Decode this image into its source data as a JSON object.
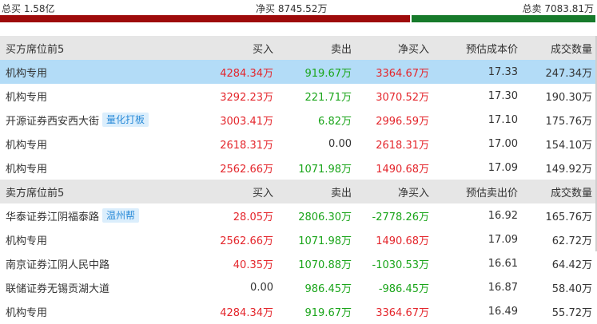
{
  "summary": {
    "buy_total": "总买 1.58亿",
    "net_total": "净买 8745.52万",
    "sell_total": "总卖 7083.81万",
    "buy_share": 0.689
  },
  "buy_section": {
    "headers": [
      "买方席位前5",
      "买入",
      "卖出",
      "净买入",
      "预估成本价",
      "成交数量"
    ],
    "rows": [
      {
        "name": "机构专用",
        "tag": "",
        "buy": "4284.34万",
        "sell": "919.67万",
        "net": "3364.67万",
        "price": "17.33",
        "volume": "247.34万",
        "net_color": "red",
        "sell_color": "green",
        "buy_color": "red",
        "selected": true
      },
      {
        "name": "机构专用",
        "tag": "",
        "buy": "3292.23万",
        "sell": "221.71万",
        "net": "3070.52万",
        "price": "17.30",
        "volume": "190.30万",
        "net_color": "red",
        "sell_color": "green",
        "buy_color": "red",
        "selected": false
      },
      {
        "name": "开源证券西安西大街",
        "tag": "量化打板",
        "buy": "3003.41万",
        "sell": "6.82万",
        "net": "2996.59万",
        "price": "17.10",
        "volume": "175.76万",
        "net_color": "red",
        "sell_color": "green",
        "buy_color": "red",
        "selected": false
      },
      {
        "name": "机构专用",
        "tag": "",
        "buy": "2618.31万",
        "sell": "0.00",
        "net": "2618.31万",
        "price": "17.00",
        "volume": "154.10万",
        "net_color": "red",
        "sell_color": "plain",
        "buy_color": "red",
        "selected": false
      },
      {
        "name": "机构专用",
        "tag": "",
        "buy": "2562.66万",
        "sell": "1071.98万",
        "net": "1490.68万",
        "price": "17.09",
        "volume": "149.92万",
        "net_color": "red",
        "sell_color": "green",
        "buy_color": "red",
        "selected": false
      }
    ]
  },
  "sell_section": {
    "headers": [
      "卖方席位前5",
      "买入",
      "卖出",
      "净买入",
      "预估卖出价",
      "成交数量"
    ],
    "rows": [
      {
        "name": "华泰证券江阴福泰路",
        "tag": "温州帮",
        "buy": "28.05万",
        "sell": "2806.30万",
        "net": "-2778.26万",
        "price": "16.92",
        "volume": "165.76万",
        "net_color": "green",
        "sell_color": "green",
        "buy_color": "red",
        "selected": false
      },
      {
        "name": "机构专用",
        "tag": "",
        "buy": "2562.66万",
        "sell": "1071.98万",
        "net": "1490.68万",
        "price": "17.09",
        "volume": "62.72万",
        "net_color": "red",
        "sell_color": "green",
        "buy_color": "red",
        "selected": false
      },
      {
        "name": "南京证券江阴人民中路",
        "tag": "",
        "buy": "40.35万",
        "sell": "1070.88万",
        "net": "-1030.53万",
        "price": "16.61",
        "volume": "64.42万",
        "net_color": "green",
        "sell_color": "green",
        "buy_color": "red",
        "selected": false
      },
      {
        "name": "联储证券无锡贡湖大道",
        "tag": "",
        "buy": "0.00",
        "sell": "986.45万",
        "net": "-986.45万",
        "price": "16.87",
        "volume": "58.40万",
        "net_color": "green",
        "sell_color": "green",
        "buy_color": "plain",
        "selected": false
      },
      {
        "name": "机构专用",
        "tag": "",
        "buy": "4284.34万",
        "sell": "919.67万",
        "net": "3364.67万",
        "price": "16.49",
        "volume": "55.72万",
        "net_color": "red",
        "sell_color": "green",
        "buy_color": "red",
        "selected": false
      }
    ]
  }
}
